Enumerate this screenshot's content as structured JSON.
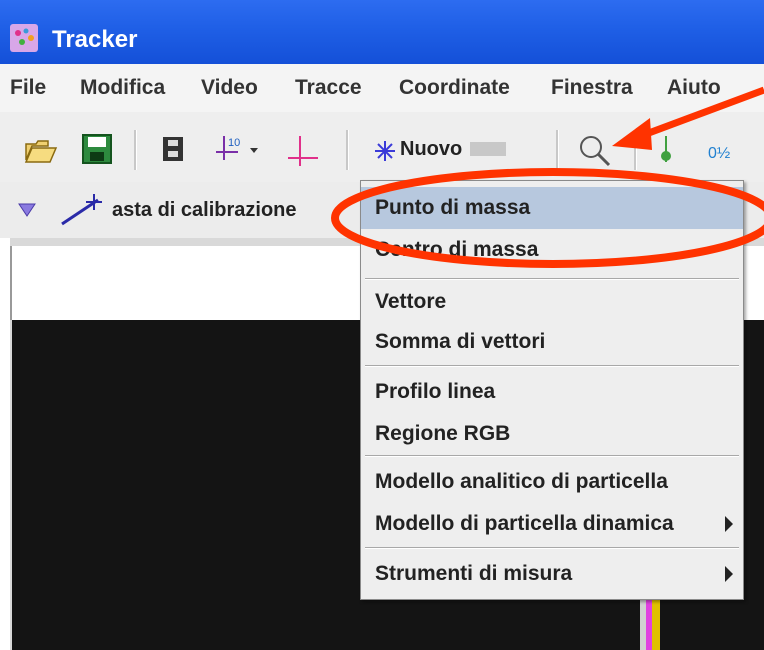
{
  "window": {
    "title": "Tracker"
  },
  "menu": [
    "File",
    "Modifica",
    "Video",
    "Tracce",
    "Coordinate",
    "Finestra",
    "Aiuto"
  ],
  "toolbar": {
    "new_label": "Nuovo"
  },
  "trackbar": {
    "track_label": "asta di calibrazione"
  },
  "dropdown": {
    "items": [
      {
        "label": "Punto di massa",
        "selected": true
      },
      {
        "label": "Centro di massa"
      },
      {
        "label": "Vettore"
      },
      {
        "label": "Somma di vettori"
      },
      {
        "label": "Profilo linea"
      },
      {
        "label": "Regione RGB"
      },
      {
        "label": "Modello analitico di particella"
      },
      {
        "label": "Modello di particella dinamica",
        "submenu": true
      },
      {
        "label": "Strumenti di misura",
        "submenu": true
      }
    ]
  },
  "colors": {
    "titlebar": "#1f5fe6",
    "annotation": "#ff3300",
    "selection": "#b7c8de"
  },
  "icons": [
    "tracker-app-icon",
    "open-folder-icon",
    "save-disk-icon",
    "clip-settings-icon",
    "coordinate-axes-menu-icon",
    "axes-icon",
    "new-track-star-icon",
    "zoom-icon",
    "calibration-stick-icon"
  ]
}
